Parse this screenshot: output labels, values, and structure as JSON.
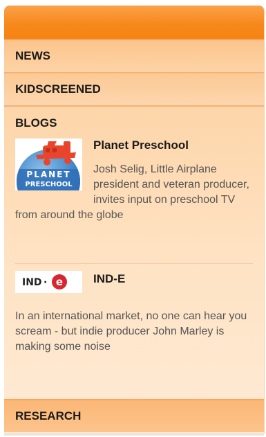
{
  "nav": {
    "news_label": "NEWS",
    "kidscreened_label": "KIDSCREENED",
    "research_label": "RESEARCH"
  },
  "blogs": {
    "heading": "BLOGS",
    "entries": [
      {
        "title": "Planet Preschool",
        "description": "Josh Selig, Little Airplane president and veteran producer, invites input on preschool TV from around the globe",
        "logo_text_line1": "PLANET",
        "logo_text_line2": "PRESCHOOL",
        "logo_icon": "planet-preschool-logo"
      },
      {
        "title": "IND-E",
        "description": "In an international market, no one can hear you scream - but indie producer John Marley is making some noise",
        "logo_text_left": "IND",
        "logo_text_dot": "·",
        "logo_text_e": "e",
        "logo_icon": "ind-e-logo"
      }
    ]
  },
  "colors": {
    "header_orange": "#f7891c",
    "panel_peach": "#fdd7ad",
    "logo_blue": "#2f6fb7",
    "logo_red": "#d8262e"
  }
}
